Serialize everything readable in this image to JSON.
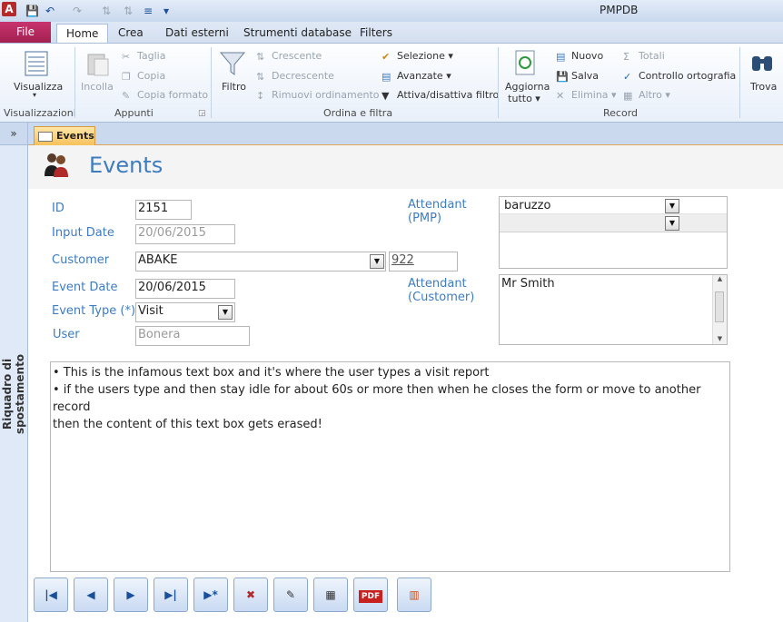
{
  "window": {
    "title": "PMPDB",
    "app_icon_letter": "A"
  },
  "ribbon_tabs": [
    "File",
    "Home",
    "Crea",
    "Dati esterni",
    "Strumenti database",
    "Filters"
  ],
  "ribbon": {
    "views": {
      "label": "Visualizza",
      "group": "Visualizzazioni"
    },
    "clipboard": {
      "paste": "Incolla",
      "cut": "Taglia",
      "copy": "Copia",
      "format_painter": "Copia formato",
      "group": "Appunti"
    },
    "sort_filter": {
      "filter": "Filtro",
      "ascending": "Crescente",
      "descending": "Decrescente",
      "remove_sort": "Rimuovi ordinamento",
      "selection": "Selezione ▾",
      "advanced": "Avanzate ▾",
      "toggle_filter": "Attiva/disattiva filtro",
      "group": "Ordina e filtra"
    },
    "records": {
      "refresh_line1": "Aggiorna",
      "refresh_line2": "tutto ▾",
      "new": "Nuovo",
      "save": "Salva",
      "delete": "Elimina ▾",
      "totals": "Totali",
      "spelling": "Controllo ortografia",
      "more": "Altro ▾",
      "group": "Record"
    },
    "find": {
      "label": "Trova"
    }
  },
  "nav_pane": {
    "toggle": "»",
    "label": "Riquadro di spostamento"
  },
  "document_tab": {
    "label": "Events"
  },
  "form": {
    "title": "Events",
    "labels": {
      "id": "ID",
      "input_date": "Input Date",
      "customer": "Customer",
      "event_date": "Event Date",
      "event_type": "Event Type (*)",
      "user": "User",
      "attendant_pmp_1": "Attendant",
      "attendant_pmp_2": "(PMP)",
      "attendant_customer_1": "Attendant",
      "attendant_customer_2": "(Customer)"
    },
    "values": {
      "id": "2151",
      "input_date": "20/06/2015",
      "customer": "ABAKE",
      "customer_code": "922",
      "event_date": "20/06/2015",
      "event_type": "Visit",
      "user": "Bonera",
      "attendant_pmp": "baruzzo",
      "attendant_customer": "Mr Smith"
    },
    "report_lines": [
      "• This is the infamous text box and it's where the user types a visit report",
      "• if the users type and then stay idle for about 60s or more then when he closes the form or move to another record",
      "then the content of this text box gets erased!"
    ]
  },
  "nav_buttons": [
    "first",
    "previous",
    "next",
    "last",
    "new-record",
    "delete-record",
    "edit-record",
    "datasheet",
    "pdf",
    "excel"
  ],
  "nav_glyphs": {
    "first": "|◀",
    "previous": "◀",
    "next": "▶",
    "last": "▶|",
    "new_record": "▶*",
    "delete_record": "✖",
    "edit_record": "✎",
    "datasheet": "▦",
    "pdf": "PDF",
    "excel": "▥"
  },
  "colors": {
    "accent": "#3e7cc0",
    "file_tab": "#b8285e",
    "doc_tab": "#f6c15a"
  }
}
